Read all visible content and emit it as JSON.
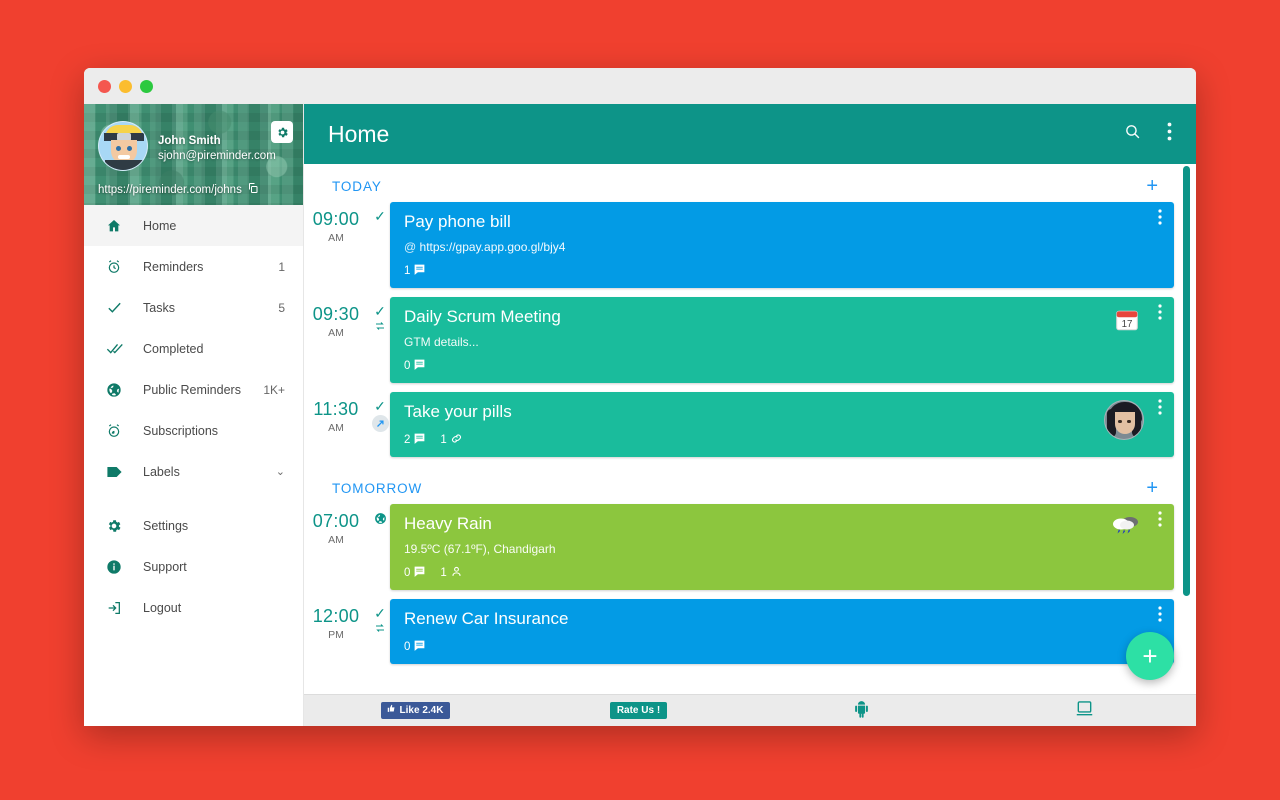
{
  "window": {
    "traffic_lights": [
      "close",
      "minimize",
      "zoom"
    ]
  },
  "sidebar": {
    "profile": {
      "name": "John Smith",
      "email": "sjohn@pireminder.com",
      "link": "https://pireminder.com/johns",
      "gear_icon": "gear-icon",
      "copy_icon": "copy-icon"
    },
    "items": [
      {
        "label": "Home",
        "count": "",
        "icon": "home-icon",
        "active": true
      },
      {
        "label": "Reminders",
        "count": "1",
        "icon": "alarm-clock-icon",
        "active": false
      },
      {
        "label": "Tasks",
        "count": "5",
        "icon": "check-icon",
        "active": false
      },
      {
        "label": "Completed",
        "count": "",
        "icon": "double-check-icon",
        "active": false
      },
      {
        "label": "Public Reminders",
        "count": "1K+",
        "icon": "globe-icon",
        "active": false
      },
      {
        "label": "Subscriptions",
        "count": "",
        "icon": "alarm-signal-icon",
        "active": false
      },
      {
        "label": "Labels",
        "count": "",
        "icon": "label-tag-icon",
        "active": false,
        "chevron": "⌄"
      }
    ],
    "footer_items": [
      {
        "label": "Settings",
        "icon": "gear-icon"
      },
      {
        "label": "Support",
        "icon": "info-icon"
      },
      {
        "label": "Logout",
        "icon": "logout-icon"
      }
    ]
  },
  "appbar": {
    "title": "Home",
    "search_icon": "search-icon",
    "overflow_icon": "kebab-menu-icon"
  },
  "sections": [
    {
      "title": "TODAY",
      "add_label": "+",
      "items": [
        {
          "time": "09:00",
          "meridiem": "AM",
          "marks": [
            "tick"
          ],
          "color": "blue",
          "title": "Pay phone bill",
          "subtitle_prefix": "@",
          "subtitle": "https://gpay.app.goo.gl/bjy4",
          "notes_count": "1",
          "attach_count": "",
          "people_count": "",
          "badge": ""
        },
        {
          "time": "09:30",
          "meridiem": "AM",
          "marks": [
            "tick",
            "repeat"
          ],
          "color": "teal",
          "title": "Daily Scrum Meeting",
          "subtitle_prefix": "",
          "subtitle": "GTM details...",
          "notes_count": "0",
          "attach_count": "",
          "people_count": "",
          "badge": "calendar-icon"
        },
        {
          "time": "11:30",
          "meridiem": "AM",
          "marks": [
            "tick",
            "pencil"
          ],
          "color": "teal",
          "title": "Take your pills",
          "subtitle_prefix": "",
          "subtitle": "",
          "notes_count": "2",
          "attach_count": "1",
          "people_count": "",
          "badge": "contact-avatar"
        }
      ]
    },
    {
      "title": "TOMORROW",
      "add_label": "+",
      "items": [
        {
          "time": "07:00",
          "meridiem": "AM",
          "marks": [
            "globe"
          ],
          "color": "green",
          "title": "Heavy Rain",
          "subtitle_prefix": "",
          "subtitle": "19.5ºC (67.1ºF), Chandigarh",
          "notes_count": "0",
          "attach_count": "",
          "people_count": "1",
          "badge": "rain-cloud-icon"
        },
        {
          "time": "12:00",
          "meridiem": "PM",
          "marks": [
            "tick",
            "repeat"
          ],
          "color": "blue",
          "title": "Renew Car Insurance",
          "subtitle_prefix": "",
          "subtitle": "",
          "notes_count": "0",
          "attach_count": "",
          "people_count": "",
          "badge": ""
        }
      ]
    }
  ],
  "fab": {
    "label": "+"
  },
  "bottombar": {
    "facebook_like": "Like 2.4K",
    "rate_us": "Rate Us !",
    "android_icon": "android-icon",
    "desktop_icon": "desktop-icon"
  },
  "glyphs": {
    "tick": "✓",
    "repeat": "⇄",
    "globe": "🌍",
    "pencil": "✎",
    "note": "▤",
    "attach": "✆",
    "person": "👤",
    "calendar": "📅",
    "rain": "🌧",
    "search": "🔍",
    "kebab": "⋮",
    "thumb": "👍"
  },
  "colors": {
    "brand_teal": "#0d9488",
    "card_blue": "#039be5",
    "card_teal": "#1abc9c",
    "card_green": "#8cc63e",
    "section_blue": "#2196f3",
    "fab_green": "#2de0a5",
    "page_red": "#f0402f"
  }
}
